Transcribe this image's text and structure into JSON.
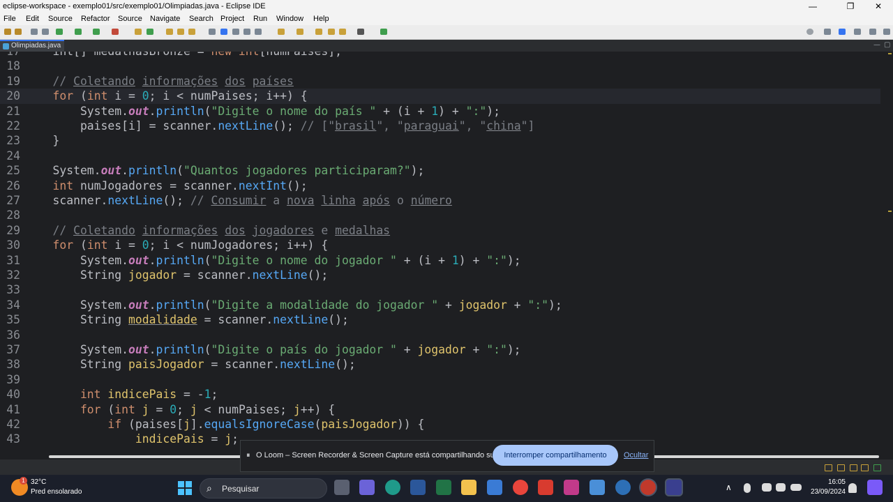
{
  "window": {
    "title": "eclipse-workspace - exemplo01/src/exemplo01/Olimpiadas.java - Eclipse IDE",
    "controls": [
      "—",
      "❐",
      "✕"
    ]
  },
  "menu": [
    "File",
    "Edit",
    "Source",
    "Refactor",
    "Source",
    "Navigate",
    "Search",
    "Project",
    "Run",
    "Window",
    "Help"
  ],
  "editor_tab": {
    "label": "Olimpiadas.java"
  },
  "code_lines": [
    {
      "n": "17",
      "parts": [
        [
          "cls",
          "    int[] medalhasBronze = "
        ],
        [
          "kw",
          "new "
        ],
        [
          "kw",
          "int"
        ],
        [
          "cls",
          "[numPaises];"
        ]
      ]
    },
    {
      "n": "18",
      "parts": []
    },
    {
      "n": "19",
      "parts": [
        [
          "cm",
          "    // "
        ],
        [
          "cmu",
          "Coletando"
        ],
        [
          "cm",
          " "
        ],
        [
          "cmu",
          "informações"
        ],
        [
          "cm",
          " "
        ],
        [
          "cmu",
          "dos"
        ],
        [
          "cm",
          " "
        ],
        [
          "cmu",
          "países"
        ]
      ]
    },
    {
      "n": "20",
      "current": true,
      "parts": [
        [
          "kw",
          "    for "
        ],
        [
          "cls",
          "("
        ],
        [
          "kw",
          "int "
        ],
        [
          "cls",
          "i = "
        ],
        [
          "num",
          "0"
        ],
        [
          "cls",
          "; i < numPaises; i++) {"
        ]
      ]
    },
    {
      "n": "21",
      "parts": [
        [
          "cls",
          "        System."
        ],
        [
          "fld",
          "out"
        ],
        [
          "cls",
          "."
        ],
        [
          "fn",
          "println"
        ],
        [
          "cls",
          "("
        ],
        [
          "str",
          "\"Digite o nome do país \""
        ],
        [
          "cls",
          " + (i + "
        ],
        [
          "num",
          "1"
        ],
        [
          "cls",
          ") + "
        ],
        [
          "str",
          "\":\""
        ],
        [
          "cls",
          ");"
        ]
      ]
    },
    {
      "n": "22",
      "parts": [
        [
          "cls",
          "        paises[i] = scanner."
        ],
        [
          "fn",
          "nextLine"
        ],
        [
          "cls",
          "(); "
        ],
        [
          "cm",
          "// [\""
        ],
        [
          "cmu",
          "brasil"
        ],
        [
          "cm",
          "\", \""
        ],
        [
          "cmu",
          "paraguai"
        ],
        [
          "cm",
          "\", \""
        ],
        [
          "cmu",
          "china"
        ],
        [
          "cm",
          "\"]"
        ]
      ]
    },
    {
      "n": "23",
      "parts": [
        [
          "cls",
          "    }"
        ]
      ]
    },
    {
      "n": "24",
      "parts": []
    },
    {
      "n": "25",
      "parts": [
        [
          "cls",
          "    System."
        ],
        [
          "fld",
          "out"
        ],
        [
          "cls",
          "."
        ],
        [
          "fn",
          "println"
        ],
        [
          "cls",
          "("
        ],
        [
          "str",
          "\"Quantos jogadores participaram?\""
        ],
        [
          "cls",
          ");"
        ]
      ]
    },
    {
      "n": "26",
      "parts": [
        [
          "kw",
          "    int "
        ],
        [
          "cls",
          "numJogadores = scanner."
        ],
        [
          "fn",
          "nextInt"
        ],
        [
          "cls",
          "();"
        ]
      ]
    },
    {
      "n": "27",
      "parts": [
        [
          "cls",
          "    scanner."
        ],
        [
          "fn",
          "nextLine"
        ],
        [
          "cls",
          "(); "
        ],
        [
          "cm",
          "// "
        ],
        [
          "cmu",
          "Consumir"
        ],
        [
          "cm",
          " a "
        ],
        [
          "cmu",
          "nova"
        ],
        [
          "cm",
          " "
        ],
        [
          "cmu",
          "linha"
        ],
        [
          "cm",
          " "
        ],
        [
          "cmu",
          "após"
        ],
        [
          "cm",
          " o "
        ],
        [
          "cmu",
          "número"
        ]
      ]
    },
    {
      "n": "28",
      "parts": []
    },
    {
      "n": "29",
      "parts": [
        [
          "cm",
          "    // "
        ],
        [
          "cmu",
          "Coletando"
        ],
        [
          "cm",
          " "
        ],
        [
          "cmu",
          "informações"
        ],
        [
          "cm",
          " "
        ],
        [
          "cmu",
          "dos"
        ],
        [
          "cm",
          " "
        ],
        [
          "cmu",
          "jogadores"
        ],
        [
          "cm",
          " e "
        ],
        [
          "cmu",
          "medalhas"
        ]
      ]
    },
    {
      "n": "30",
      "parts": [
        [
          "kw",
          "    for "
        ],
        [
          "cls",
          "("
        ],
        [
          "kw",
          "int "
        ],
        [
          "cls",
          "i = "
        ],
        [
          "num",
          "0"
        ],
        [
          "cls",
          "; i < numJogadores; i++) {"
        ]
      ]
    },
    {
      "n": "31",
      "parts": [
        [
          "cls",
          "        System."
        ],
        [
          "fld",
          "out"
        ],
        [
          "cls",
          "."
        ],
        [
          "fn",
          "println"
        ],
        [
          "cls",
          "("
        ],
        [
          "str",
          "\"Digite o nome do jogador \""
        ],
        [
          "cls",
          " + (i + "
        ],
        [
          "num",
          "1"
        ],
        [
          "cls",
          ") + "
        ],
        [
          "str",
          "\":\""
        ],
        [
          "cls",
          ");"
        ]
      ]
    },
    {
      "n": "32",
      "parts": [
        [
          "cls",
          "        String "
        ],
        [
          "var",
          "jogador"
        ],
        [
          "cls",
          " = scanner."
        ],
        [
          "fn",
          "nextLine"
        ],
        [
          "cls",
          "();"
        ]
      ]
    },
    {
      "n": "33",
      "parts": []
    },
    {
      "n": "34",
      "parts": [
        [
          "cls",
          "        System."
        ],
        [
          "fld",
          "out"
        ],
        [
          "cls",
          "."
        ],
        [
          "fn",
          "println"
        ],
        [
          "cls",
          "("
        ],
        [
          "str",
          "\"Digite a modalidade do jogador \""
        ],
        [
          "cls",
          " + "
        ],
        [
          "var",
          "jogador"
        ],
        [
          "cls",
          " + "
        ],
        [
          "str",
          "\":\""
        ],
        [
          "cls",
          ");"
        ]
      ]
    },
    {
      "n": "35",
      "parts": [
        [
          "cls",
          "        String "
        ],
        [
          "varu",
          "modalidade"
        ],
        [
          "cls",
          " = scanner."
        ],
        [
          "fn",
          "nextLine"
        ],
        [
          "cls",
          "();"
        ]
      ]
    },
    {
      "n": "36",
      "parts": []
    },
    {
      "n": "37",
      "parts": [
        [
          "cls",
          "        System."
        ],
        [
          "fld",
          "out"
        ],
        [
          "cls",
          "."
        ],
        [
          "fn",
          "println"
        ],
        [
          "cls",
          "("
        ],
        [
          "str",
          "\"Digite o país do jogador \""
        ],
        [
          "cls",
          " + "
        ],
        [
          "var",
          "jogador"
        ],
        [
          "cls",
          " + "
        ],
        [
          "str",
          "\":\""
        ],
        [
          "cls",
          ");"
        ]
      ]
    },
    {
      "n": "38",
      "parts": [
        [
          "cls",
          "        String "
        ],
        [
          "var",
          "paisJogador"
        ],
        [
          "cls",
          " = scanner."
        ],
        [
          "fn",
          "nextLine"
        ],
        [
          "cls",
          "();"
        ]
      ]
    },
    {
      "n": "39",
      "parts": []
    },
    {
      "n": "40",
      "parts": [
        [
          "kw",
          "        int "
        ],
        [
          "var",
          "indicePais"
        ],
        [
          "cls",
          " = -"
        ],
        [
          "num",
          "1"
        ],
        [
          "cls",
          ";"
        ]
      ]
    },
    {
      "n": "41",
      "parts": [
        [
          "kw",
          "        for "
        ],
        [
          "cls",
          "("
        ],
        [
          "kw",
          "int "
        ],
        [
          "var",
          "j"
        ],
        [
          "cls",
          " = "
        ],
        [
          "num",
          "0"
        ],
        [
          "cls",
          "; "
        ],
        [
          "var",
          "j"
        ],
        [
          "cls",
          " < numPaises; "
        ],
        [
          "var",
          "j"
        ],
        [
          "cls",
          "++) {"
        ]
      ]
    },
    {
      "n": "42",
      "parts": [
        [
          "kw",
          "            if "
        ],
        [
          "cls",
          "(paises["
        ],
        [
          "var",
          "j"
        ],
        [
          "cls",
          "]."
        ],
        [
          "fn",
          "equalsIgnoreCase"
        ],
        [
          "cls",
          "("
        ],
        [
          "var",
          "paisJogador"
        ],
        [
          "cls",
          ")) {"
        ]
      ]
    },
    {
      "n": "43",
      "parts": [
        [
          "cls",
          "                "
        ],
        [
          "var",
          "indicePais"
        ],
        [
          "cls",
          " = "
        ],
        [
          "var",
          "j"
        ],
        [
          "cls",
          ";"
        ]
      ]
    }
  ],
  "loom_banner": {
    "pause_glyph": "⏸",
    "message": "O Loom – Screen Recorder & Screen Capture está compartilhando sua tela.",
    "stop_label": "Interromper compartilhamento",
    "hide_label": "Ocultar"
  },
  "taskbar": {
    "weather_badge": "1",
    "temperature": "32°C",
    "weather": "Pred ensolarado",
    "search_placeholder": "Pesquisar",
    "search_icon": "⌕",
    "tray_chevron": "∧",
    "time": "16:05",
    "date": "23/09/2024"
  },
  "icons": {
    "weather": "sun-icon",
    "search": "search-icon",
    "start": "windows-start-icon"
  },
  "colors": {
    "keyword": "#cf8e6d",
    "string": "#6aab73",
    "number": "#2aacb8",
    "comment": "#7a7e85",
    "field": "#c77dbb",
    "method": "#56a8f5",
    "local_var": "#e0c46c",
    "loom_button": "#a8c7fa"
  }
}
